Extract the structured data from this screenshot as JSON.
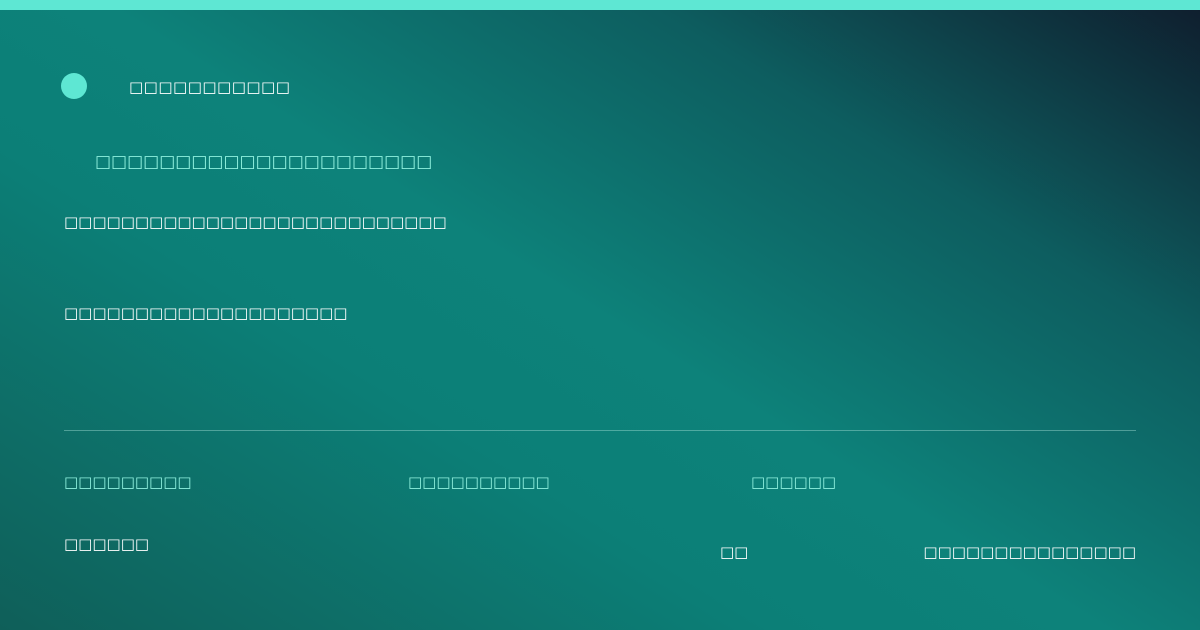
{
  "colors": {
    "accent": "#5ee7d3",
    "kicker_text": "#8ff0de",
    "gradient_dark": "#0f1d2d",
    "gradient_mid": "#0d827a",
    "text_primary": "#ffffff"
  },
  "brand": {
    "icon": "circle-logo-icon",
    "name": "□□□□□□□□□□□"
  },
  "hero": {
    "kicker": "□□□□□□□□□□□□□□□□□□□□□",
    "headline": "□□□□□□□□□□□□□□□□□□□□□□□□□□□",
    "subline": "□□□□□□□□□□□□□□□□□□□□"
  },
  "meta": {
    "item_1": "□□□□□□□□□",
    "item_2": "□□□□□□□□□□",
    "item_3": "□□□□□□"
  },
  "footer": {
    "left": "□□□□□□",
    "middle": "□□",
    "right": "□□□□□□□□□□□□□□□"
  }
}
